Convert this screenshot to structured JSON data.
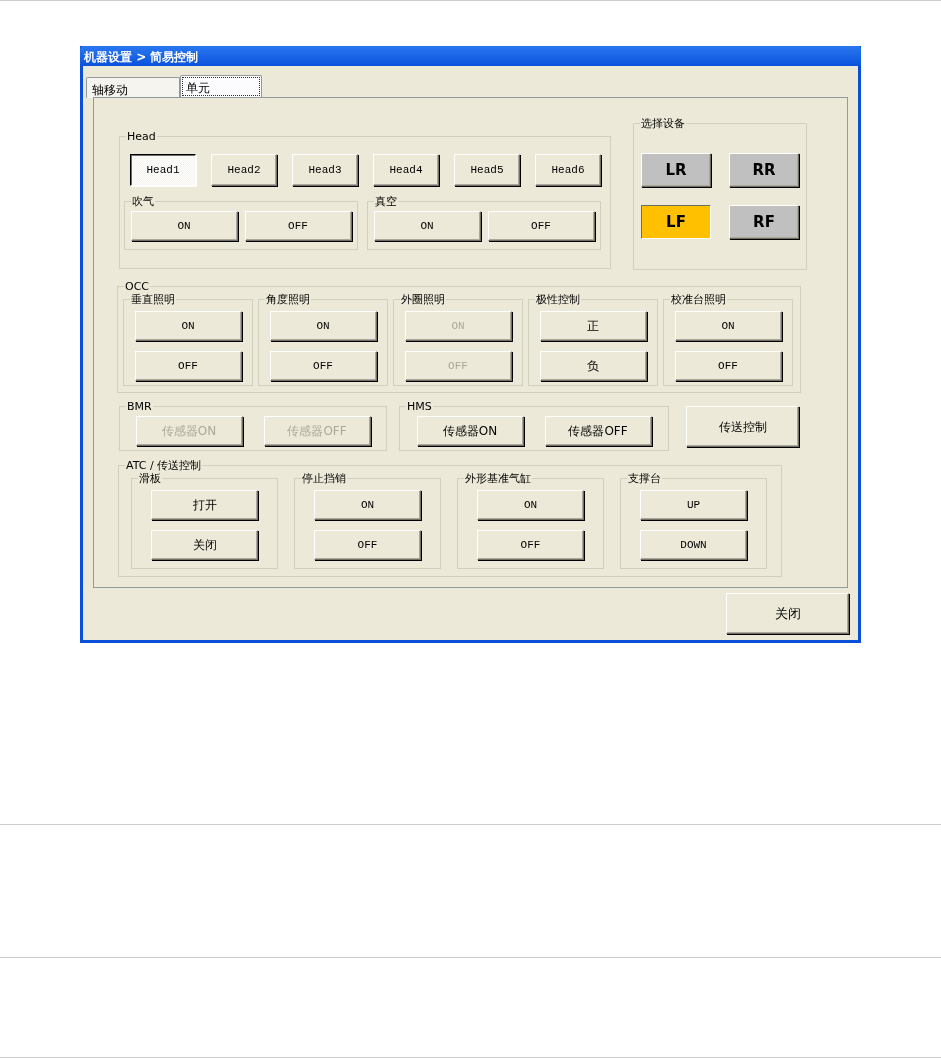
{
  "window": {
    "title": "机器设置 > 简易控制"
  },
  "tabs": [
    {
      "label": "轴移动",
      "selected": false
    },
    {
      "label": "单元",
      "selected": true
    }
  ],
  "head_group": {
    "title": "Head",
    "heads": [
      {
        "label": "Head1",
        "selected": true
      },
      {
        "label": "Head2",
        "selected": false
      },
      {
        "label": "Head3",
        "selected": false
      },
      {
        "label": "Head4",
        "selected": false
      },
      {
        "label": "Head5",
        "selected": false
      },
      {
        "label": "Head6",
        "selected": false
      }
    ],
    "subgroups": [
      {
        "title": "吹气",
        "buttons": [
          {
            "label": "ON",
            "disabled": false
          },
          {
            "label": "OFF",
            "disabled": false
          }
        ]
      },
      {
        "title": "真空",
        "buttons": [
          {
            "label": "ON",
            "disabled": false
          },
          {
            "label": "OFF",
            "disabled": false
          }
        ]
      }
    ]
  },
  "device_group": {
    "title": "选择设备",
    "devices": [
      {
        "label": "LR",
        "selected": false
      },
      {
        "label": "RR",
        "selected": false
      },
      {
        "label": "LF",
        "selected": true
      },
      {
        "label": "RF",
        "selected": false
      }
    ]
  },
  "occ": {
    "title": "OCC",
    "groups": [
      {
        "title": "垂直照明",
        "buttons": [
          {
            "label": "ON",
            "disabled": false
          },
          {
            "label": "OFF",
            "disabled": false
          }
        ]
      },
      {
        "title": "角度照明",
        "buttons": [
          {
            "label": "ON",
            "disabled": false
          },
          {
            "label": "OFF",
            "disabled": false
          }
        ]
      },
      {
        "title": "外圈照明",
        "buttons": [
          {
            "label": "ON",
            "disabled": true
          },
          {
            "label": "OFF",
            "disabled": true
          }
        ]
      },
      {
        "title": "极性控制",
        "buttons": [
          {
            "label": "正",
            "disabled": false
          },
          {
            "label": "负",
            "disabled": false
          }
        ]
      },
      {
        "title": "校准台照明",
        "buttons": [
          {
            "label": "ON",
            "disabled": false
          },
          {
            "label": "OFF",
            "disabled": false
          }
        ]
      }
    ]
  },
  "bmr": {
    "title": "BMR",
    "buttons": [
      {
        "label": "传感器ON",
        "disabled": true
      },
      {
        "label": "传感器OFF",
        "disabled": true
      }
    ]
  },
  "hms": {
    "title": "HMS",
    "buttons": [
      {
        "label": "传感器ON",
        "disabled": false
      },
      {
        "label": "传感器OFF",
        "disabled": false
      }
    ]
  },
  "transfer_button": "传送控制",
  "atc": {
    "title": "ATC / 传送控制",
    "groups": [
      {
        "title": "滑板",
        "buttons": [
          {
            "label": "打开",
            "disabled": false
          },
          {
            "label": "关闭",
            "disabled": false
          }
        ]
      },
      {
        "title": "停止挡销",
        "buttons": [
          {
            "label": "ON",
            "disabled": false
          },
          {
            "label": "OFF",
            "disabled": false
          }
        ]
      },
      {
        "title": "外形基准气缸",
        "buttons": [
          {
            "label": "ON",
            "disabled": false
          },
          {
            "label": "OFF",
            "disabled": false
          }
        ]
      },
      {
        "title": "支撑台",
        "buttons": [
          {
            "label": "UP",
            "disabled": false
          },
          {
            "label": "DOWN",
            "disabled": false
          }
        ]
      }
    ]
  },
  "close_button": "关闭"
}
